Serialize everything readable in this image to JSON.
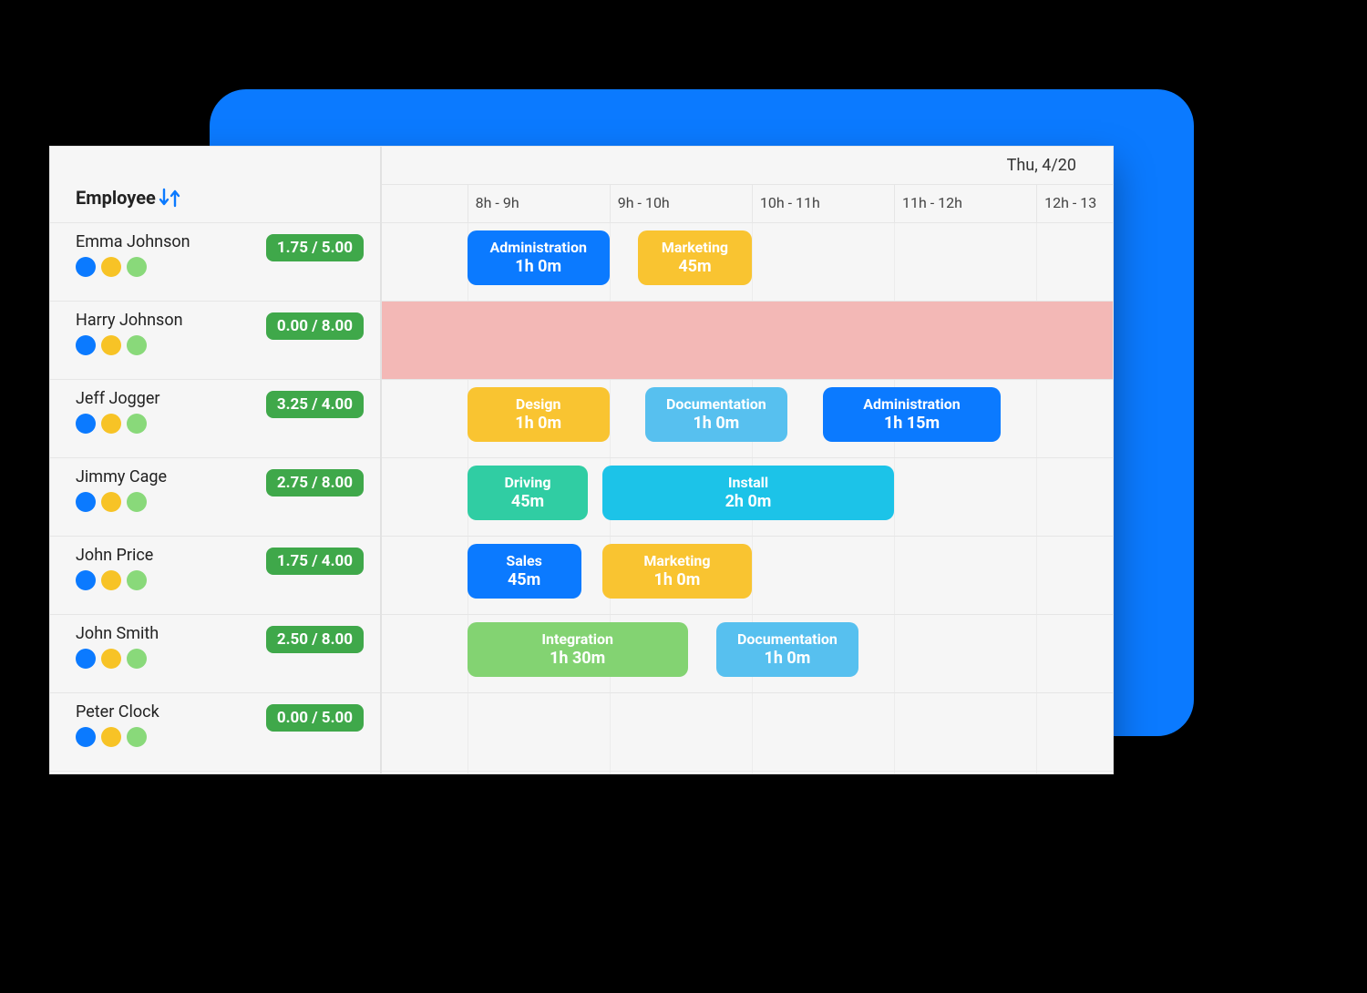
{
  "header": {
    "employee_label": "Employee",
    "date_label": "Thu, 4/20",
    "hour_labels": [
      "8h - 9h",
      "9h - 10h",
      "10h - 11h",
      "11h - 12h",
      "12h - 13"
    ]
  },
  "timeline": {
    "start_hour": 7.4,
    "end_hour": 12.55,
    "grid_hours": [
      8,
      9,
      10,
      11,
      12
    ]
  },
  "colors": {
    "blue": "#0b7aff",
    "yellow": "#f9c431",
    "sky": "#57c0ef",
    "teal": "#30cda3",
    "cyan": "#1cc3e8",
    "green": "#83d372",
    "badge": "#3fa84a"
  },
  "employees": [
    {
      "name": "Emma Johnson",
      "badge": "1.75 / 5.00",
      "highlight": false,
      "tasks": [
        {
          "title": "Administration",
          "duration": "1h 0m",
          "start": 8.0,
          "end": 9.0,
          "color": "blue"
        },
        {
          "title": "Marketing",
          "duration": "45m",
          "start": 9.2,
          "end": 10.0,
          "color": "yellow"
        }
      ]
    },
    {
      "name": "Harry Johnson",
      "badge": "0.00 / 8.00",
      "highlight": true,
      "tasks": []
    },
    {
      "name": "Jeff Jogger",
      "badge": "3.25 / 4.00",
      "highlight": false,
      "tasks": [
        {
          "title": "Design",
          "duration": "1h 0m",
          "start": 8.0,
          "end": 9.0,
          "color": "yellow"
        },
        {
          "title": "Documentation",
          "duration": "1h 0m",
          "start": 9.25,
          "end": 10.25,
          "color": "sky"
        },
        {
          "title": "Administration",
          "duration": "1h 15m",
          "start": 10.5,
          "end": 11.75,
          "color": "blue"
        }
      ]
    },
    {
      "name": "Jimmy Cage",
      "badge": "2.75 / 8.00",
      "highlight": false,
      "tasks": [
        {
          "title": "Driving",
          "duration": "45m",
          "start": 8.0,
          "end": 8.85,
          "color": "teal"
        },
        {
          "title": "Install",
          "duration": "2h 0m",
          "start": 8.95,
          "end": 11.0,
          "color": "cyan"
        }
      ]
    },
    {
      "name": "John Price",
      "badge": "1.75 / 4.00",
      "highlight": false,
      "tasks": [
        {
          "title": "Sales",
          "duration": "45m",
          "start": 8.0,
          "end": 8.8,
          "color": "blue"
        },
        {
          "title": "Marketing",
          "duration": "1h 0m",
          "start": 8.95,
          "end": 10.0,
          "color": "yellow"
        }
      ]
    },
    {
      "name": "John Smith",
      "badge": "2.50 / 8.00",
      "highlight": false,
      "tasks": [
        {
          "title": "Integration",
          "duration": "1h 30m",
          "start": 8.0,
          "end": 9.55,
          "color": "green"
        },
        {
          "title": "Documentation",
          "duration": "1h 0m",
          "start": 9.75,
          "end": 10.75,
          "color": "sky"
        }
      ]
    },
    {
      "name": "Peter Clock",
      "badge": "0.00 / 5.00",
      "highlight": false,
      "tasks": []
    }
  ]
}
